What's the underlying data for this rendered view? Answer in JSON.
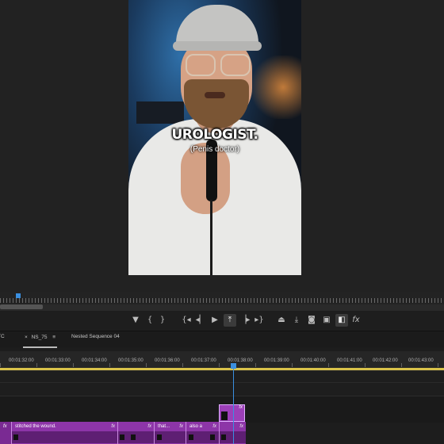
{
  "video": {
    "caption_title": "UROLOGIST.",
    "caption_sub": "(Penis doctor)"
  },
  "transport": {
    "buttons": [
      "marker-icon",
      "in-icon",
      "out-icon",
      "go-to-in-icon",
      "step-back-icon",
      "play-icon",
      "insert-icon",
      "step-forward-icon",
      "go-to-out-icon",
      "lift-icon",
      "extract-icon",
      "camera-icon",
      "settings-icon",
      "compare-icon",
      "fx-icon"
    ],
    "fx_label": "fx"
  },
  "timeline": {
    "tab_left_partial": "TC",
    "active_tab": "NS_75",
    "close_glyph": "×",
    "menu_glyph": "≡",
    "other_tab": "Nested Sequence 04",
    "timecodes": [
      "00:01:32:00",
      "00:01:33:00",
      "00:01:34:00",
      "00:01:35:00",
      "00:01:36:00",
      "00:01:37:00",
      "00:01:38:00",
      "00:01:39:00",
      "00:01:40:00",
      "00:01:41:00",
      "00:01:42:00",
      "00:01:43:00"
    ]
  },
  "clips": {
    "nested_fx": "fx",
    "head_fx": "fx",
    "caption_clips": [
      {
        "label": "stitched the wound.",
        "fx": "fx"
      },
      {
        "label": "",
        "fx": "fx"
      },
      {
        "label": "that...",
        "fx": "fx"
      },
      {
        "label": "also a",
        "fx": "fx"
      },
      {
        "label": "",
        "fx": "fx"
      }
    ]
  },
  "colors": {
    "clip_purple": "#8d35a8",
    "playhead_blue": "#3a8fe0",
    "work_area_yellow": "#d9c24a"
  }
}
